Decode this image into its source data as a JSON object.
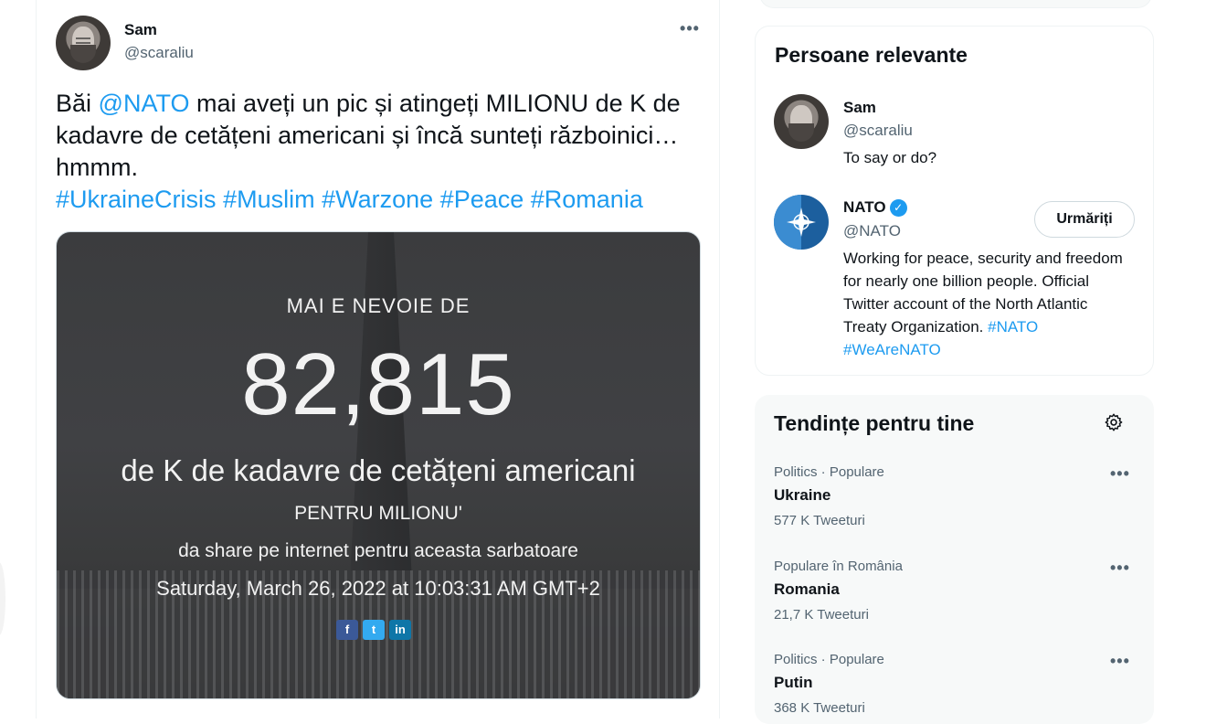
{
  "tweet": {
    "author_name": "Sam",
    "author_handle": "@scaraliu",
    "more_label": "•••",
    "text_prefix": "Băi ",
    "mention": "@NATO",
    "text_body": " mai aveți un pic și atingeți MILIONU de K de kadavre de cetățeni americani și încă sunteți războinici… hmmm.",
    "hashtags": [
      "#UkraineCrisis",
      "#Muslim",
      "#Warzone",
      "#Peace",
      "#Romania"
    ],
    "media": {
      "line1": "MAI E NEVOIE DE",
      "number": "82,815",
      "line2": "de K de kadavre de cetățeni americani",
      "line3": "PENTRU MILIONU'",
      "line4": "da share pe internet pentru aceasta sarbatoare",
      "date": "Saturday, March 26, 2022 at 10:03:31 AM GMT+2",
      "share_icons": [
        "f",
        "t",
        "in"
      ]
    }
  },
  "relevant": {
    "title": "Persoane relevante",
    "people": [
      {
        "name": "Sam",
        "handle": "@scaraliu",
        "bio": "To say or do?"
      },
      {
        "name": "NATO",
        "handle": "@NATO",
        "verified": true,
        "bio_text": "Working for peace, security and freedom for nearly one billion people. Official Twitter account of the North Atlantic Treaty Organization. ",
        "bio_tags": [
          "#NATO",
          "#WeAreNATO"
        ],
        "follow_label": "Urmăriți"
      }
    ]
  },
  "trends": {
    "title": "Tendințe pentru tine",
    "items": [
      {
        "meta": "Politics · Populare",
        "name": "Ukraine",
        "count": "577 K Tweeturi"
      },
      {
        "meta": "Populare în România",
        "name": "Romania",
        "count": "21,7 K Tweeturi"
      },
      {
        "meta": "Politics · Populare",
        "name": "Putin",
        "count": "368 K Tweeturi"
      }
    ]
  },
  "colors": {
    "link": "#1d9bf0",
    "text": "#0f1419",
    "muted": "#536471",
    "verified": "#1d9bf0"
  }
}
